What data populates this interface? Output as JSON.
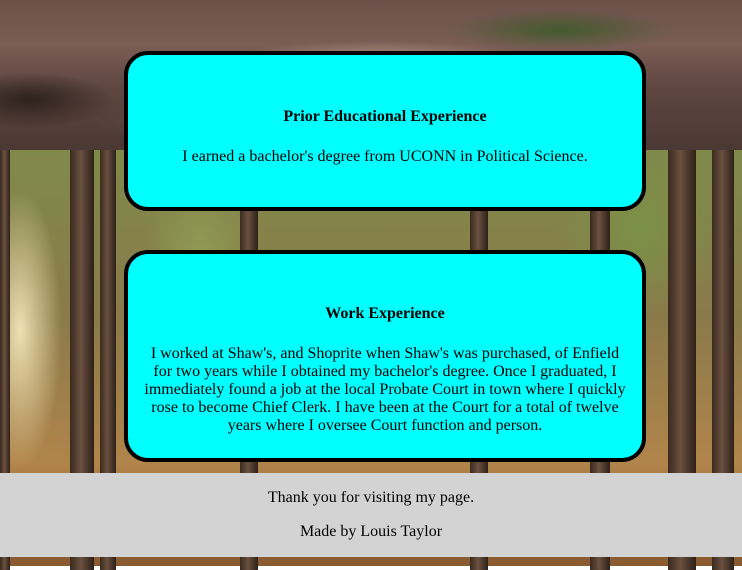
{
  "education": {
    "heading": "Prior Educational Experience",
    "text": "I earned a bachelor's degree from UCONN in Political Science."
  },
  "work": {
    "heading": "Work Experience",
    "text": "I worked at Shaw's, and Shoprite when Shaw's was purchased, of Enfield for two years while I obtained my bachelor's degree. Once I graduated, I immediately found a job at the local Probate Court in town where I quickly rose to become Chief Clerk. I have been at the Court for a total of twelve years where I oversee Court function and person."
  },
  "footer": {
    "thanks": "Thank you for visiting my page.",
    "made_by": "Made by Louis Taylor"
  },
  "colors": {
    "card_background": "#00ffff",
    "card_border": "#000000",
    "footer_background": "#d3d3d3"
  }
}
